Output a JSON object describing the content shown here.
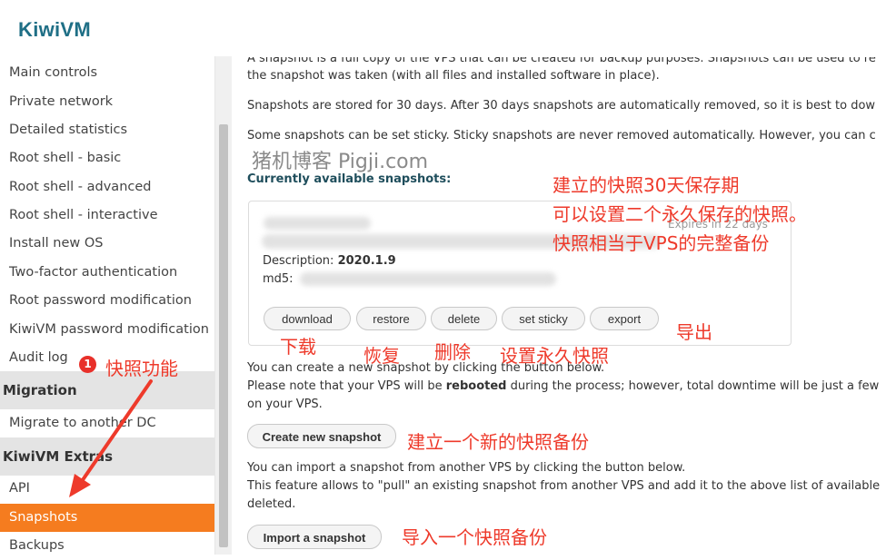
{
  "brand": {
    "logo": "KiwiVM"
  },
  "sidebar": {
    "items": [
      {
        "label": "Main controls"
      },
      {
        "label": "Private network"
      },
      {
        "label": "Detailed statistics"
      },
      {
        "label": "Root shell - basic"
      },
      {
        "label": "Root shell - advanced"
      },
      {
        "label": "Root shell - interactive"
      },
      {
        "label": "Install new OS"
      },
      {
        "label": "Two-factor authentication"
      },
      {
        "label": "Root password modification"
      },
      {
        "label": "KiwiVM password modification"
      },
      {
        "label": "Audit log"
      }
    ],
    "migration_header": "Migration",
    "migration_items": [
      {
        "label": "Migrate to another DC"
      }
    ],
    "extras_header": "KiwiVM Extras",
    "extras_items": [
      {
        "label": "API"
      },
      {
        "label": "Snapshots",
        "active": true
      },
      {
        "label": "Backups"
      }
    ]
  },
  "main": {
    "intro_line1": "A snapshot is a full copy of the VPS that can be created for backup purposes. Snapshots can be used to re",
    "intro_line2": "the snapshot was taken (with all files and installed software in place).",
    "stored_text": "Snapshots are stored for 30 days. After 30 days snapshots are automatically removed, so it is best to dow",
    "sticky_text": "Some snapshots can be set sticky. Sticky snapshots are never removed automatically. However, you can c",
    "available_title": "Currently available snapshots:",
    "snapshot": {
      "expires": "Expires in 22 days",
      "description_label": "Description:",
      "description_value": "2020.1.9",
      "md5_label": "md5:"
    },
    "snapshot_buttons": {
      "download": "download",
      "restore": "restore",
      "delete": "delete",
      "set_sticky": "set sticky",
      "export": "export"
    },
    "create_text1": "You can create a new snapshot by clicking the button below.",
    "create_text2_pre": "Please note that your VPS will be ",
    "create_text2_bold": "rebooted",
    "create_text2_post": " during the process; however, total downtime will be just a few",
    "create_text3": "on your VPS.",
    "create_button": "Create new snapshot",
    "import_text1": "You can import a snapshot from another VPS by clicking the button below.",
    "import_text2": "This feature allows to \"pull\" an existing snapshot from another VPS and add it to the above list of available",
    "import_text3": "deleted.",
    "import_button": "Import a snapshot"
  },
  "annotations": {
    "watermark": "猪机博客 Pigji.com",
    "note1": "建立的快照30天保存期",
    "note2": "可以设置二个永久保存的快照。",
    "note3": "快照相当于VPS的完整备份",
    "download": "下载",
    "restore": "恢复",
    "delete": "删除",
    "set_sticky": "设置永久快照",
    "export": "导出",
    "badge_number": "1",
    "snapshot_feature": "快照功能",
    "create": "建立一个新的快照备份",
    "import": "导入一个快照备份"
  },
  "colors": {
    "active_item": "#f57c1f",
    "annotation": "#ee3a2b",
    "logo": "#1f6f86",
    "section_title": "#1f4e5c"
  }
}
